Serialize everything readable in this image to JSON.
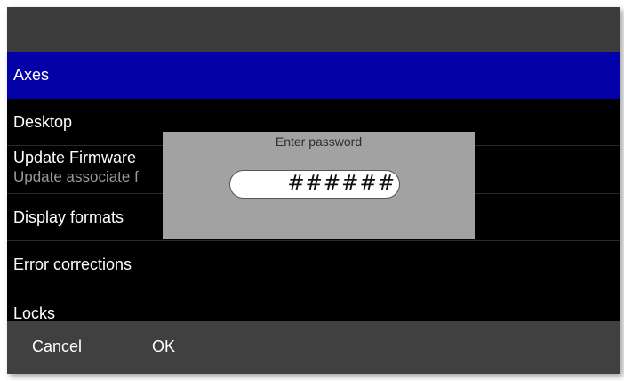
{
  "menu": {
    "items": [
      {
        "label": "Axes",
        "selected": true
      },
      {
        "label": "Desktop"
      },
      {
        "label": "Update Firmware",
        "subtitle": "Update associate f"
      },
      {
        "label": "Display formats"
      },
      {
        "label": "Error corrections"
      },
      {
        "label": "Locks"
      }
    ]
  },
  "dialog": {
    "title": "Enter password",
    "password_value": "######"
  },
  "footer": {
    "cancel_label": "Cancel",
    "ok_label": "OK"
  },
  "colors": {
    "selection": "#0400a8",
    "dialog_bg": "#a2a2a2",
    "bar_bg": "#404040"
  }
}
